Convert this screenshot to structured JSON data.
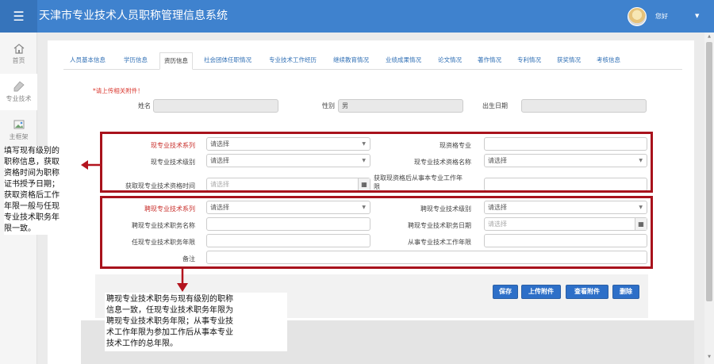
{
  "app": {
    "title": "天津市专业技术人员职称管理信息系统",
    "greeting": "您好",
    "menu_icon": "hamburger-icon"
  },
  "sidebar": {
    "items": [
      {
        "label": "首页",
        "icon": "home-icon"
      },
      {
        "label": "专业技术",
        "icon": "flask-icon"
      },
      {
        "label": "主框架",
        "icon": "image-icon"
      }
    ]
  },
  "tabs": [
    "人员基本信息",
    "学历信息",
    "资历信息",
    "社会团体任职情况",
    "专业技术工作经历",
    "继续教育情况",
    "业绩成果情况",
    "论文情况",
    "著作情况",
    "专利情况",
    "获奖情况",
    "考核信息"
  ],
  "active_tab": "资历信息",
  "form": {
    "required_note": "*请上传相关附件！",
    "name_label": "姓名",
    "name_value": "",
    "gender_label": "性别",
    "gender_value": "男",
    "birth_label": "出生日期",
    "birth_value": "",
    "current": {
      "series_label": "现专业技术系列",
      "series_value": "请选择",
      "level_label": "现专业技术级别",
      "level_value": "请选择",
      "time_label": "获取现专业技术资格时间",
      "time_placeholder": "请选择",
      "major_label": "现资格专业",
      "major_value": "",
      "qual_name_label": "现专业技术资格名称",
      "qual_name_value": "请选择",
      "years_after_label_1": "获取现资格后从事本专业工作年",
      "years_after_label_2": "限",
      "years_after_value": ""
    },
    "employ": {
      "series_label": "聘现专业技术系列",
      "series_value": "请选择",
      "post_name_label": "聘现专业技术职务名称",
      "post_name_value": "",
      "years_label": "任现专业技术职务年限",
      "years_value": "",
      "remark_label": "备注",
      "remark_value": "",
      "level_label": "聘现专业技术级别",
      "level_value": "请选择",
      "date_label": "聘现专业技术职务日期",
      "date_placeholder": "请选择",
      "work_years_label": "从事专业技术工作年限",
      "work_years_value": ""
    }
  },
  "buttons": {
    "save": "保存",
    "upload": "上传附件",
    "view": "查看附件",
    "delete": "删除"
  },
  "annotations": {
    "left": [
      "填写现有级别的",
      "职称信息，获取",
      "资格时间为职称",
      "证书授予日期；",
      "获取资格后工作",
      "年限一般与任现",
      "专业技术职务年",
      "限一致。"
    ],
    "bottom": [
      "聘现专业技术职务与现有级别的职称",
      "信息一致，任现专业技术职务年限为",
      "聘现专业技术职务年限；从事专业技",
      "术工作年限为参加工作后从事本专业",
      "技术工作的总年限。"
    ]
  },
  "colors": {
    "header": "#3f82ce",
    "highlight_box": "#a8121c",
    "button": "#2d6fc8",
    "required": "#c9302c"
  }
}
